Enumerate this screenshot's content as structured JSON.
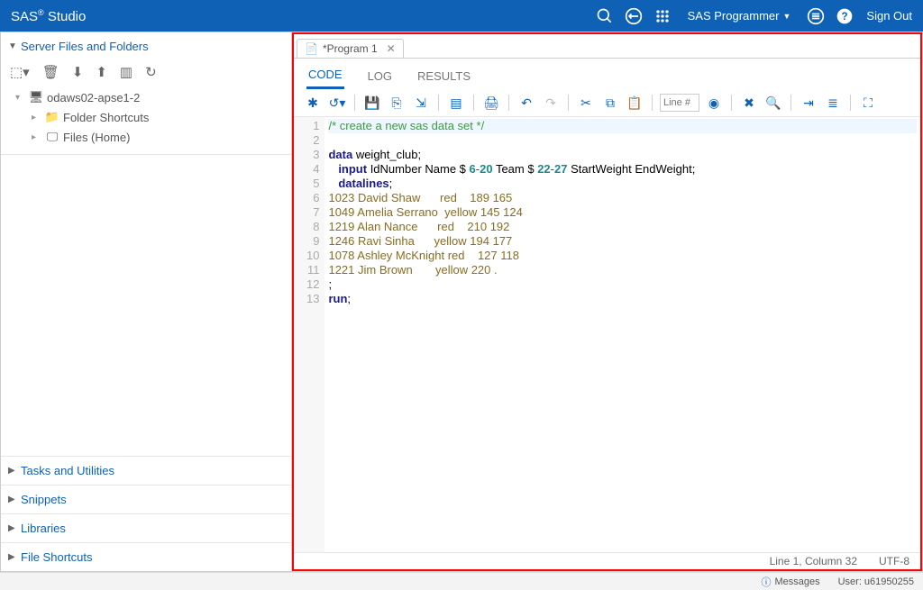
{
  "header": {
    "title_prefix": "SAS",
    "title_reg": "®",
    "title_suffix": " Studio",
    "user": "SAS Programmer",
    "signout": "Sign Out"
  },
  "sidebar": {
    "sections": {
      "server": {
        "label": "Server Files and Folders",
        "expanded": true,
        "root": "odaws02-apse1-2",
        "children": [
          {
            "label": "Folder Shortcuts"
          },
          {
            "label": "Files (Home)"
          }
        ]
      },
      "tasks": {
        "label": "Tasks and Utilities"
      },
      "snippets": {
        "label": "Snippets"
      },
      "libraries": {
        "label": "Libraries"
      },
      "file_shortcuts": {
        "label": "File Shortcuts"
      }
    }
  },
  "workarea": {
    "tab_label": "*Program 1",
    "subtabs": {
      "code": "CODE",
      "log": "LOG",
      "results": "RESULTS"
    },
    "line_placeholder": "Line #",
    "status": {
      "pos": "Line 1, Column 32",
      "encoding": "UTF-8"
    },
    "code_lines": [
      {
        "n": 1,
        "hl": true,
        "tokens": [
          {
            "t": "/* create a new sas data set */",
            "c": "c-comment"
          }
        ]
      },
      {
        "n": 2,
        "tokens": []
      },
      {
        "n": 3,
        "tokens": [
          {
            "t": "data",
            "c": "c-kw"
          },
          {
            "t": " weight_club;",
            "c": ""
          }
        ]
      },
      {
        "n": 4,
        "tokens": [
          {
            "t": "   ",
            "c": ""
          },
          {
            "t": "input",
            "c": "c-kw"
          },
          {
            "t": " IdNumber Name $ ",
            "c": ""
          },
          {
            "t": "6",
            "c": "c-num"
          },
          {
            "t": "-",
            "c": "c-op"
          },
          {
            "t": "20",
            "c": "c-num"
          },
          {
            "t": " Team $ ",
            "c": ""
          },
          {
            "t": "22",
            "c": "c-num"
          },
          {
            "t": "-",
            "c": "c-op"
          },
          {
            "t": "27",
            "c": "c-num"
          },
          {
            "t": " StartWeight EndWeight;",
            "c": ""
          }
        ]
      },
      {
        "n": 5,
        "tokens": [
          {
            "t": "   ",
            "c": ""
          },
          {
            "t": "datalines",
            "c": "c-kw"
          },
          {
            "t": ";",
            "c": ""
          }
        ]
      },
      {
        "n": 6,
        "tokens": [
          {
            "t": "1023 David Shaw      red    189 165",
            "c": "c-val"
          }
        ]
      },
      {
        "n": 7,
        "tokens": [
          {
            "t": "1049 Amelia Serrano  yellow 145 124",
            "c": "c-val"
          }
        ]
      },
      {
        "n": 8,
        "tokens": [
          {
            "t": "1219 Alan Nance      red    210 192",
            "c": "c-val"
          }
        ]
      },
      {
        "n": 9,
        "tokens": [
          {
            "t": "1246 Ravi Sinha      yellow 194 177",
            "c": "c-val"
          }
        ]
      },
      {
        "n": 10,
        "tokens": [
          {
            "t": "1078 Ashley McKnight red    127 118",
            "c": "c-val"
          }
        ]
      },
      {
        "n": 11,
        "tokens": [
          {
            "t": "1221 Jim Brown       yellow 220 .",
            "c": "c-val"
          }
        ]
      },
      {
        "n": 12,
        "tokens": [
          {
            "t": ";",
            "c": ""
          }
        ]
      },
      {
        "n": 13,
        "tokens": [
          {
            "t": "run",
            "c": "c-kw"
          },
          {
            "t": ";",
            "c": ""
          }
        ]
      }
    ]
  },
  "bottombar": {
    "messages": "Messages",
    "user_label": "User: u61950255"
  }
}
